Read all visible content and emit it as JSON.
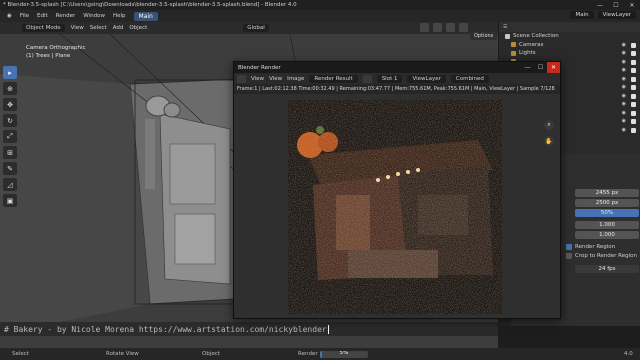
{
  "window": {
    "title": "* Blender-3.5-splash [C:\\Users\\gsing\\Downloads\\blender-3.5-splash\\blender-3.5-splash.blend] - Blender 4.0",
    "min": "—",
    "max": "☐",
    "close": "✕"
  },
  "menu": {
    "items": [
      "File",
      "Edit",
      "Render",
      "Window",
      "Help"
    ],
    "workspace": "Main",
    "scene": "Main",
    "view_layer": "ViewLayer"
  },
  "viewport": {
    "mode": "Object Mode",
    "menus": [
      "View",
      "Select",
      "Add",
      "Object"
    ],
    "orientation": "Global",
    "camera_label": "Camera Orthographic",
    "collection_label": "(1) Trees | Plane",
    "options": "Options"
  },
  "text_editor": {
    "line": "# Bakery - by Nicole Morena https://www.artstation.com/nickyblender"
  },
  "render_window": {
    "title": "Blender Render",
    "menus": [
      "View",
      "View",
      "Image"
    ],
    "image_name": "Render Result",
    "slot": "Slot 1",
    "view_layer": "ViewLayer",
    "pass": "Combined",
    "info": "Frame:1 | Last:02:12.38 Time:00:32.49 | Remaining:03:47.77 | Mem:755.61M, Peak:755.61M | Main, ViewLayer | Sample 7/128"
  },
  "outliner": {
    "filter": "Scene Collection",
    "items": [
      "Cameras",
      "Lights",
      "",
      "",
      "",
      "",
      "",
      "",
      "",
      "",
      "",
      ""
    ]
  },
  "properties": {
    "resolution_x": "2455 px",
    "resolution_y": "2500 px",
    "resolution_pct": "50%",
    "aspect_x": "1.000",
    "aspect_y": "1.000",
    "render_region": "Render Region",
    "crop_region": "Crop to Render Region",
    "frame_rate": "24 fps"
  },
  "status": {
    "select": "Select",
    "rotate": "Rotate View",
    "object": "Object",
    "render": "Render",
    "progress_label": "5%",
    "progress": 0.05,
    "version": "4.0"
  },
  "colors": {
    "accent": "#4772b3",
    "close": "#c42b1c"
  }
}
